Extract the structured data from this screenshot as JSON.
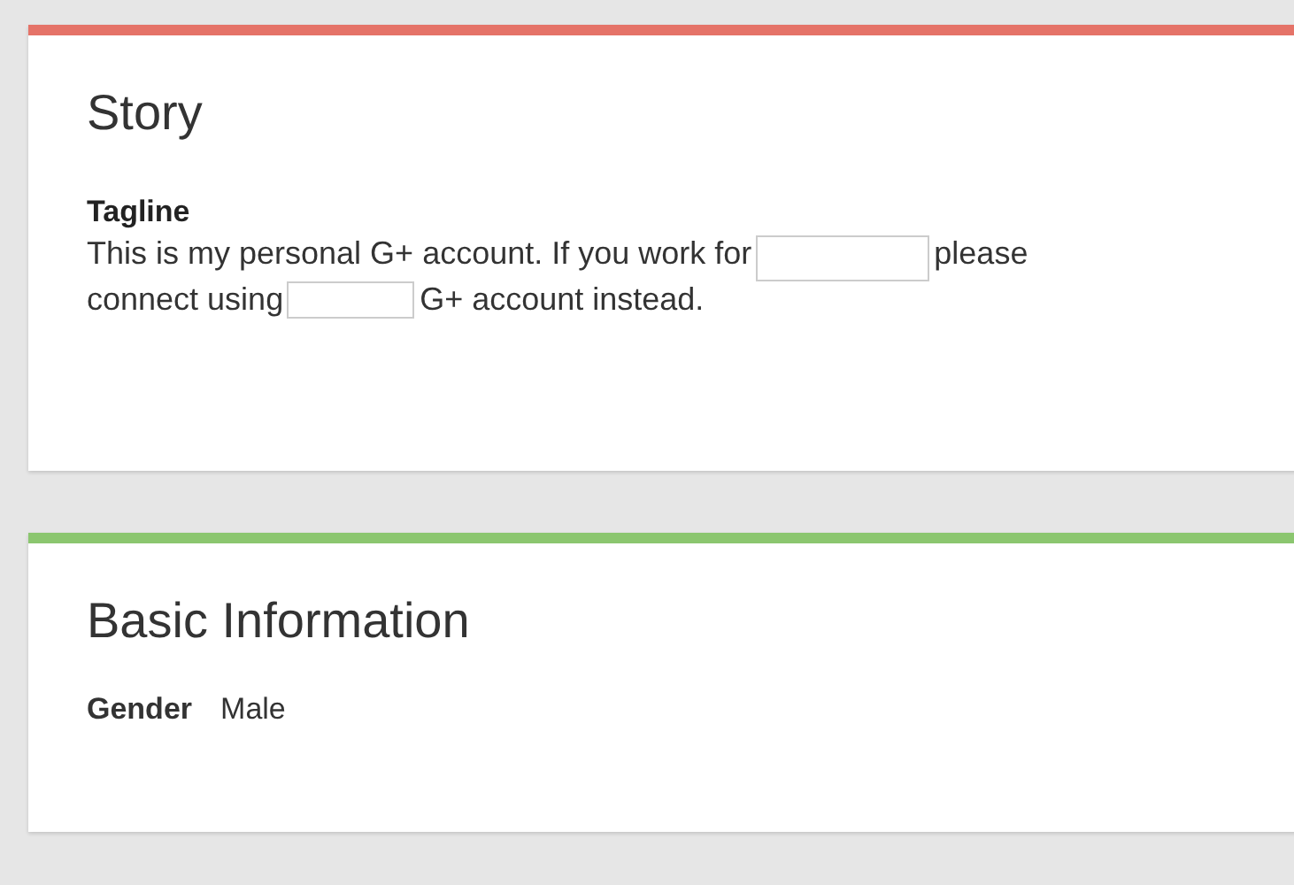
{
  "cards": [
    {
      "title": "Story",
      "color": "#e57368",
      "kind": "tagline",
      "label": "Tagline",
      "lines": [
        [
          {
            "kind": "text",
            "text": "This is my personal G+ account. If you work for"
          },
          {
            "kind": "redacted"
          },
          {
            "kind": "text",
            "text": "please"
          }
        ],
        [
          {
            "kind": "text",
            "text": "connect using"
          },
          {
            "kind": "redacted"
          },
          {
            "kind": "text",
            "text": "G+ account instead."
          }
        ]
      ]
    },
    {
      "title": "Basic Information",
      "color": "#8bc66f",
      "kind": "fields",
      "fields": [
        {
          "label": "Gender",
          "value": "Male"
        }
      ]
    }
  ]
}
